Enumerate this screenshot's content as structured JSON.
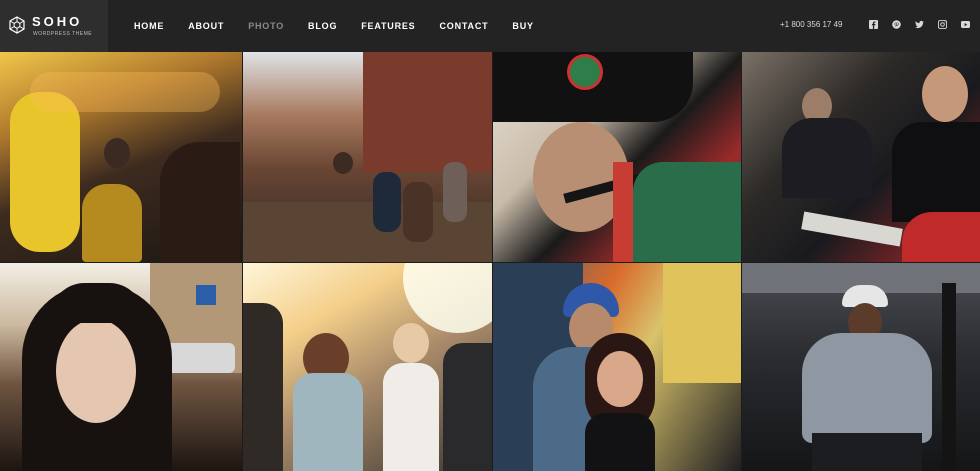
{
  "brand": {
    "name": "SOHO",
    "tagline": "WordPress Theme"
  },
  "nav": [
    {
      "label": "HOME",
      "active": false
    },
    {
      "label": "ABOUT",
      "active": false
    },
    {
      "label": "PHOTO",
      "active": true
    },
    {
      "label": "BLOG",
      "active": false
    },
    {
      "label": "FEATURES",
      "active": false
    },
    {
      "label": "CONTACT",
      "active": false
    },
    {
      "label": "BUY",
      "active": false
    }
  ],
  "phone": "+1 800 356 17 49",
  "social_icons": [
    "facebook-icon",
    "pinterest-icon",
    "twitter-icon",
    "instagram-icon",
    "youtube-icon"
  ],
  "gallery": [
    {
      "subject": "street-violinist"
    },
    {
      "subject": "rooftop-party"
    },
    {
      "subject": "drummer-soldier"
    },
    {
      "subject": "business-meeting"
    },
    {
      "subject": "street-portrait"
    },
    {
      "subject": "friends-sunset"
    },
    {
      "subject": "graffiti-couple"
    },
    {
      "subject": "police-officer"
    }
  ],
  "colors": {
    "topbar": "#232323",
    "logo_box": "#2e2e2e",
    "nav_text": "#ffffff",
    "nav_active": "#8a8a8a"
  }
}
